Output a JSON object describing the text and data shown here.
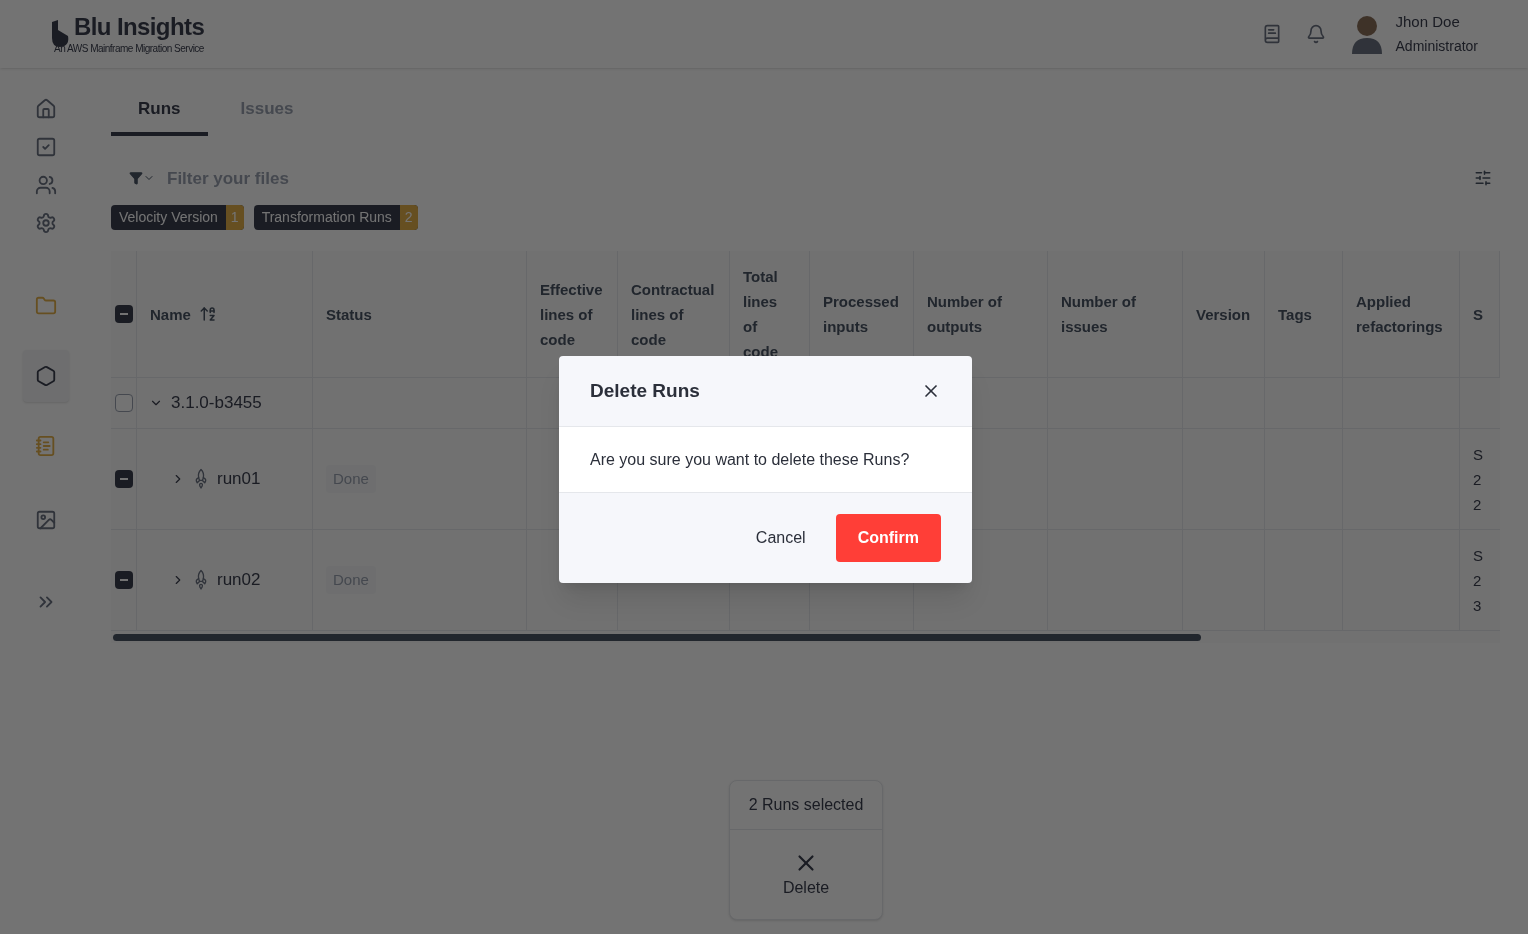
{
  "brand": {
    "name": "Blu Insights",
    "tagline": "An AWS Mainframe Migration Service"
  },
  "user": {
    "name": "Jhon Doe",
    "role": "Administrator"
  },
  "sidebar": {
    "items": [
      {
        "selected": false
      },
      {
        "selected": false
      },
      {
        "selected": false
      },
      {
        "selected": false
      },
      {
        "selected": false
      },
      {
        "selected": true
      },
      {
        "selected": false
      },
      {
        "selected": false
      },
      {
        "selected": false
      }
    ]
  },
  "tabs": [
    {
      "label": "Runs",
      "selected": true
    },
    {
      "label": "Issues",
      "selected": false
    }
  ],
  "filter": {
    "placeholder": "Filter your files"
  },
  "chips": [
    {
      "label": "Velocity Version",
      "count": "1"
    },
    {
      "label": "Transformation Runs",
      "count": "2"
    }
  ],
  "table": {
    "all_checked": true,
    "columns": [
      "Name",
      "Status",
      "Effective lines of code",
      "Contractual lines of code",
      "Total lines of code",
      "Processed inputs",
      "Number of outputs",
      "Number of issues",
      "Version",
      "Tags",
      "Applied refactorings",
      "S"
    ],
    "rows": [
      {
        "kind": "group",
        "name": "3.1.0-b3455",
        "checked": false,
        "expanded": true
      },
      {
        "kind": "run",
        "name": "run01",
        "status": "Done",
        "checked": true,
        "expanded": false,
        "column_13": [
          "S",
          "2",
          "2"
        ]
      },
      {
        "kind": "run",
        "name": "run02",
        "status": "Done",
        "checked": true,
        "expanded": false,
        "column_13": [
          "S",
          "2",
          "3"
        ]
      }
    ]
  },
  "selection_bar": {
    "count_text": "2 Runs selected",
    "action": "Delete"
  },
  "dialog": {
    "title": "Delete Runs",
    "message": "Are you sure you want to delete these Runs?",
    "buttons": [
      "Cancel",
      "Confirm"
    ]
  }
}
